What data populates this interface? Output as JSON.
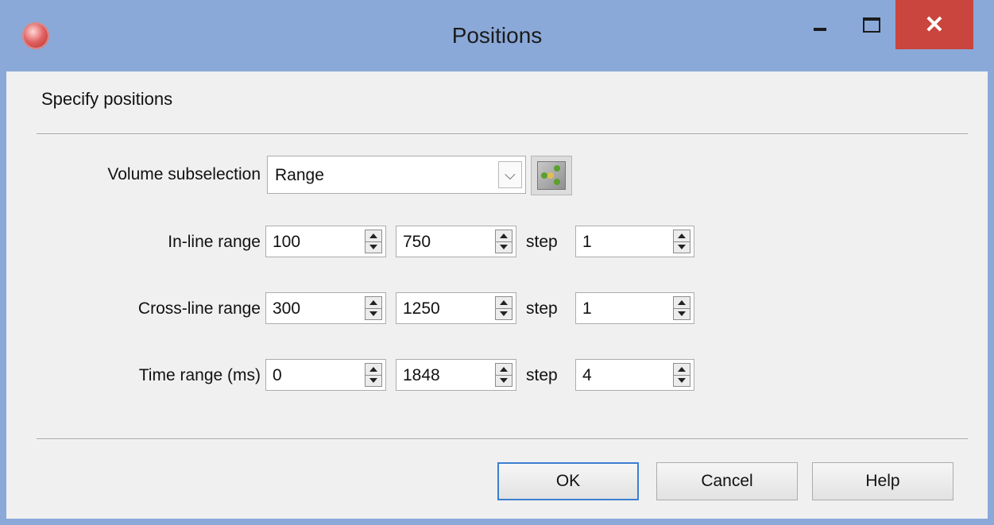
{
  "window": {
    "title": "Positions",
    "close_glyph": "✕",
    "icons": {
      "app": "app-logo-icon",
      "minimize": "minimize-icon",
      "maximize": "maximize-icon",
      "close": "close-icon"
    },
    "accent_color": "#8aa9d9",
    "close_color": "#c9453d"
  },
  "header": {
    "subtitle": "Specify positions"
  },
  "volume": {
    "label": "Volume subselection",
    "selected": "Range",
    "dropdown_glyph": "⌵",
    "tool_icon": "volume-cube-icon"
  },
  "ranges": {
    "step_label": "step",
    "inline": {
      "label": "In-line range",
      "start": "100",
      "stop": "750",
      "step": "1"
    },
    "crossline": {
      "label": "Cross-line range",
      "start": "300",
      "stop": "1250",
      "step": "1"
    },
    "time": {
      "label": "Time range (ms)",
      "start": "0",
      "stop": "1848",
      "step": "4"
    }
  },
  "buttons": {
    "ok": "OK",
    "cancel": "Cancel",
    "help": "Help"
  }
}
